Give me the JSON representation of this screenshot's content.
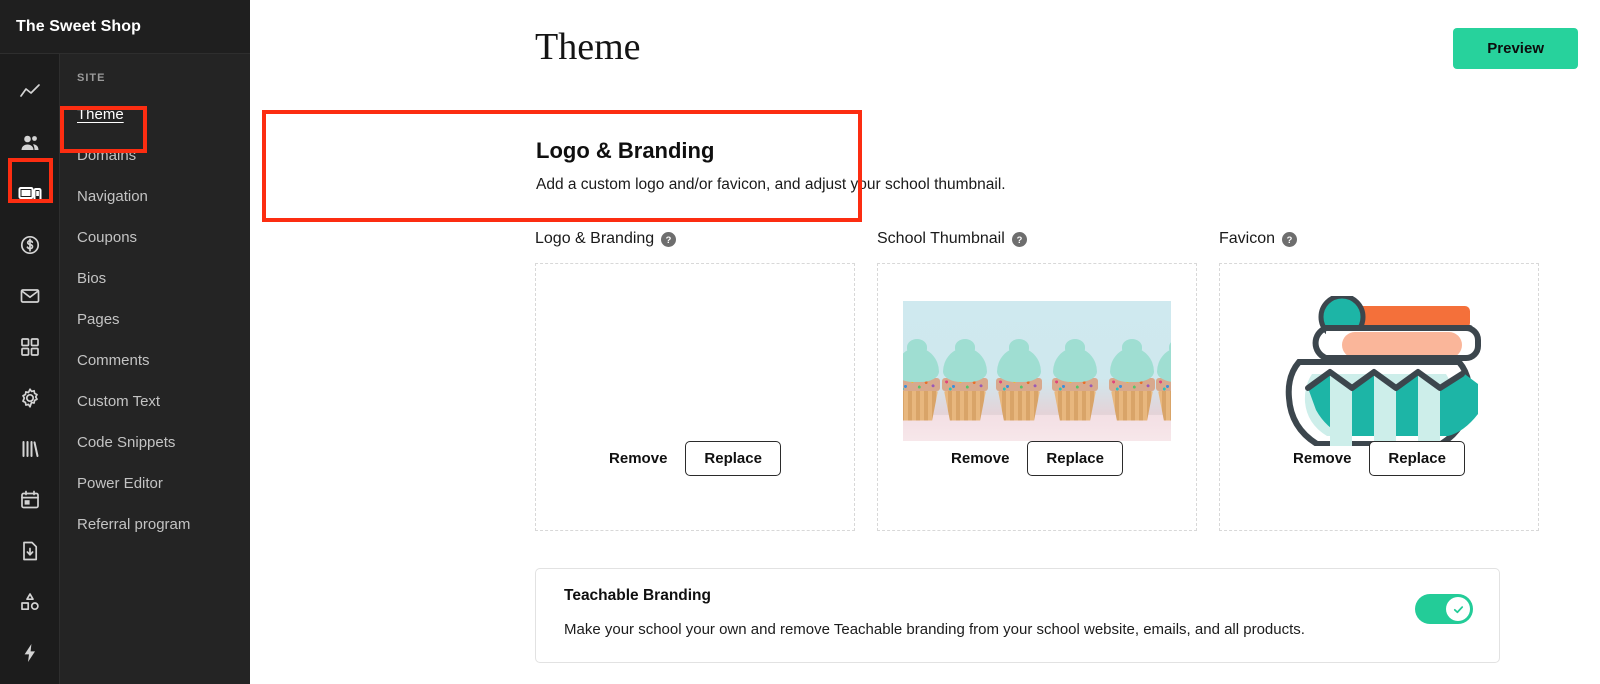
{
  "sidebar": {
    "brand_title": "The Sweet Shop",
    "rail_icons": [
      {
        "name": "analytics-icon"
      },
      {
        "name": "users-icon"
      },
      {
        "name": "site-icon"
      },
      {
        "name": "sales-dollar-icon"
      },
      {
        "name": "email-envelope-icon"
      },
      {
        "name": "apps-grid-icon"
      },
      {
        "name": "settings-gear-icon"
      },
      {
        "name": "library-books-icon"
      },
      {
        "name": "calendar-icon"
      },
      {
        "name": "file-download-icon"
      },
      {
        "name": "shapes-icon"
      },
      {
        "name": "lightning-bolt-icon"
      }
    ],
    "section_heading": "SITE",
    "items": [
      {
        "label": "Theme"
      },
      {
        "label": "Domains"
      },
      {
        "label": "Navigation"
      },
      {
        "label": "Coupons"
      },
      {
        "label": "Bios"
      },
      {
        "label": "Pages"
      },
      {
        "label": "Comments"
      },
      {
        "label": "Custom Text"
      },
      {
        "label": "Code Snippets"
      },
      {
        "label": "Power Editor"
      },
      {
        "label": "Referral program"
      }
    ],
    "selected_item": "Theme"
  },
  "header": {
    "page_title": "Theme",
    "preview_label": "Preview"
  },
  "info_card": {
    "title": "Logo & Branding",
    "subtitle": "Add a custom logo and/or favicon, and adjust your school thumbnail."
  },
  "uploads": [
    {
      "label": "Logo & Branding",
      "help_icon": "help-circle-icon",
      "has_image": false,
      "remove_label": "Remove",
      "replace_label": "Replace"
    },
    {
      "label": "School Thumbnail",
      "help_icon": "help-circle-icon",
      "has_image": true,
      "image_name": "cupcakes-photo",
      "remove_label": "Remove",
      "replace_label": "Replace"
    },
    {
      "label": "Favicon",
      "help_icon": "help-circle-icon",
      "has_image": true,
      "image_name": "candy-jar-favicon",
      "remove_label": "Remove",
      "replace_label": "Replace"
    }
  ],
  "teachable_branding": {
    "title": "Teachable Branding",
    "description": "Make your school your own and remove Teachable branding from your school website, emails, and all products.",
    "toggle_on": true
  },
  "annotations": [
    {
      "name": "highlight-site-rail-icon"
    },
    {
      "name": "highlight-theme-menu-item"
    },
    {
      "name": "highlight-logo-branding-card"
    }
  ],
  "colors": {
    "accent_green": "#27d29c",
    "toggle_green": "#23cc98",
    "annotation_red": "#fc2d11",
    "sidebar_dark": "#1c1c1c",
    "menu_dark": "#242424"
  }
}
